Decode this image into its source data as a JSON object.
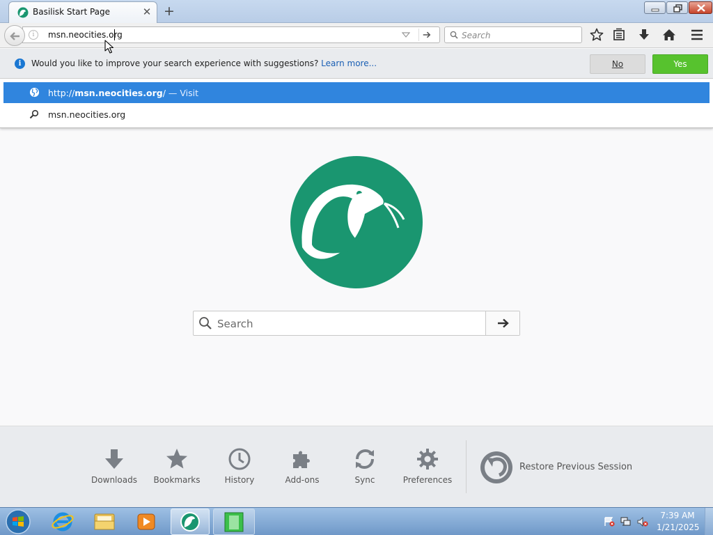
{
  "browser": {
    "tab_title": "Basilisk Start Page",
    "tab_close": "✕",
    "new_tab": "+"
  },
  "navbar": {
    "url_value": "msn.neocities.org",
    "search_placeholder": "Search"
  },
  "notification": {
    "message": "Would you like to improve your search experience with suggestions?",
    "link": "Learn more...",
    "no_label": "No",
    "yes_label": "Yes"
  },
  "autocomplete": {
    "visit_prefix": "http://",
    "visit_bold": "msn.neocities.org",
    "visit_suffix": "/",
    "visit_action": "— Visit",
    "search_suggestion": "msn.neocities.org"
  },
  "main": {
    "search_placeholder": "Search"
  },
  "launcher": {
    "items": [
      {
        "label": "Downloads",
        "icon": "download-arrow-icon"
      },
      {
        "label": "Bookmarks",
        "icon": "star-icon"
      },
      {
        "label": "History",
        "icon": "clock-icon"
      },
      {
        "label": "Add-ons",
        "icon": "puzzle-icon"
      },
      {
        "label": "Sync",
        "icon": "sync-icon"
      },
      {
        "label": "Preferences",
        "icon": "gear-icon"
      }
    ],
    "restore_label": "Restore Previous Session"
  },
  "taskbar": {
    "time": "7:39 AM",
    "date": "1/21/2025"
  },
  "colors": {
    "accent_green": "#1a9670",
    "selection_blue": "#3085de",
    "yes_green": "#57c22e"
  }
}
